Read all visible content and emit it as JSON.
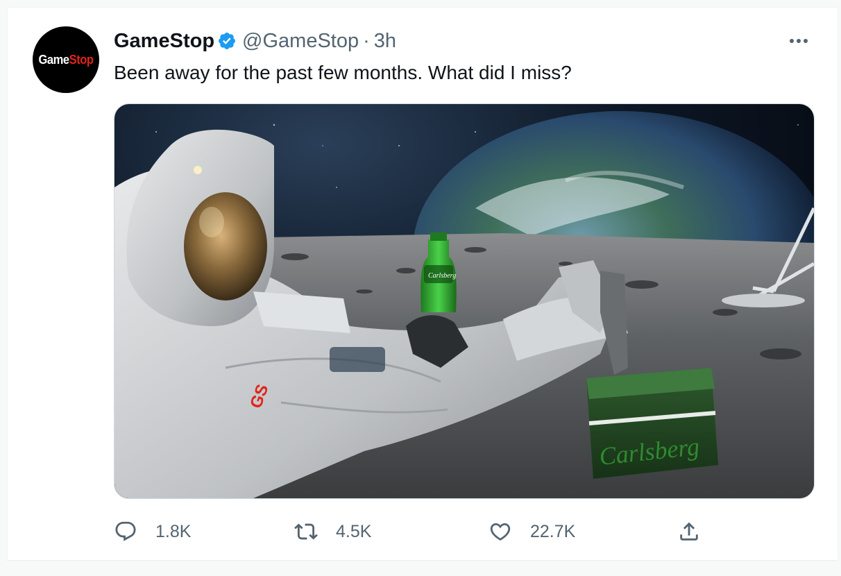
{
  "tweet": {
    "avatar": {
      "logo_text_white": "Game",
      "logo_text_red": "Stop"
    },
    "display_name": "GameStop",
    "verified_icon": "verified-badge-icon",
    "handle": "@GameStop",
    "separator": "·",
    "time": "3h",
    "more_icon": "more-horizontal-icon",
    "text": "Been away for the past few months. What did I miss?",
    "media": {
      "description_icon": "photo",
      "patch_text": "GS",
      "bottle_label": "Carlsberg",
      "cooler_label": "Carlsberg"
    },
    "actions": {
      "reply": {
        "icon": "reply-icon",
        "count": "1.8K"
      },
      "retweet": {
        "icon": "retweet-icon",
        "count": "4.5K"
      },
      "like": {
        "icon": "heart-icon",
        "count": "22.7K"
      },
      "share": {
        "icon": "share-icon"
      }
    }
  },
  "colors": {
    "accent": "#1d9bf0",
    "secondary_text": "#536471",
    "primary_text": "#0f1419",
    "gamestop_red": "#e2231a"
  }
}
